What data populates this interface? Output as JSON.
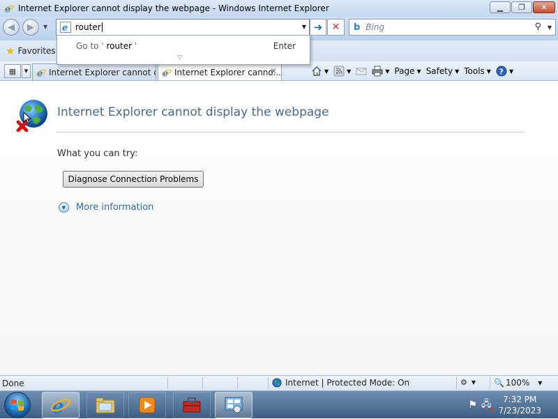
{
  "window": {
    "title": "Internet Explorer cannot display the webpage - Windows Internet Explorer",
    "minimize_icon": "minimize-icon",
    "maximize_icon": "maximize-icon",
    "close_icon": "close-icon"
  },
  "navigation": {
    "address_value": "router",
    "search_placeholder": "Bing",
    "autocomplete": {
      "goto_prefix": "Go to '",
      "goto_term": " router ",
      "goto_suffix": "'",
      "enter_label": "Enter"
    }
  },
  "favorites_bar": {
    "label": "Favorites"
  },
  "tabs": [
    {
      "label": "Internet Explorer cannot di...",
      "active": false
    },
    {
      "label": "Internet Explorer canno...",
      "active": true
    }
  ],
  "command_bar": {
    "page_label": "Page",
    "safety_label": "Safety",
    "tools_label": "Tools"
  },
  "content": {
    "heading": "Internet Explorer cannot display the webpage",
    "what_you_can_try": "What you can try:",
    "diagnose_button": "Diagnose Connection Problems",
    "more_information": "More information"
  },
  "status_bar": {
    "status": "Done",
    "zone": "Internet | Protected Mode: On",
    "zoom": "100%"
  },
  "taskbar": {
    "time": "7:32 PM",
    "date": "7/23/2023"
  },
  "colors": {
    "accent_link": "#2a6ab3",
    "heading": "#4a6a8b",
    "close_button": "#c94e31"
  }
}
